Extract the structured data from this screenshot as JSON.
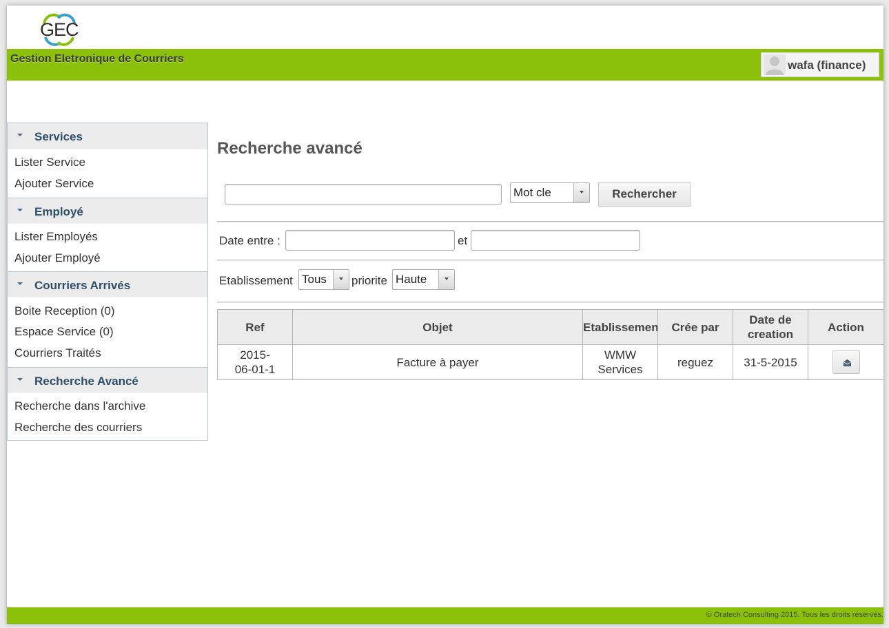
{
  "logo": {
    "text": "GEC",
    "icon": "gec-logo-icon"
  },
  "header": {
    "title": "Gestion Eletronique de Courriers",
    "background": "#8bc10a",
    "user": {
      "name": "wafa (finance)",
      "avatar_icon": "user-avatar-icon"
    }
  },
  "sidebar": {
    "sections": [
      {
        "title": "Services",
        "items": [
          "Lister Service",
          "Ajouter Service"
        ]
      },
      {
        "title": "Employé",
        "items": [
          "Lister Employés",
          "Ajouter Employé"
        ]
      },
      {
        "title": "Courriers Arrivés",
        "items": [
          "Boite Reception (0)",
          "Espace Service (0)",
          "Courriers Traités"
        ]
      },
      {
        "title": "Recherche Avancé",
        "items": [
          "Recherche dans l'archive",
          "Recherche des courriers"
        ]
      }
    ]
  },
  "main": {
    "title": "Recherche avancé",
    "search": {
      "value": "",
      "type_selected": "Mot cle",
      "button_label": "Rechercher"
    },
    "date_filter": {
      "label": "Date entre :",
      "and_label": "et",
      "from_value": "",
      "to_value": ""
    },
    "filters": {
      "etablissement_label": "Etablissement",
      "etablissement_selected": "Tous",
      "priorite_label": "priorite",
      "priorite_selected": "Haute"
    },
    "table": {
      "columns": [
        "Ref",
        "Objet",
        "Etablissement",
        "Crée par",
        "Date de creation",
        "Action"
      ],
      "rows": [
        {
          "ref": "2015-06-01-1",
          "objet": "Facture à payer",
          "etablissement": "WMW Services",
          "cree_par": "reguez",
          "date": "31-5-2015",
          "action_icon": "open-envelope-icon"
        }
      ]
    }
  },
  "footer": {
    "text": "© Oratech Consulting 2015. Tous les droits réservés.",
    "background": "#8bc10a"
  }
}
